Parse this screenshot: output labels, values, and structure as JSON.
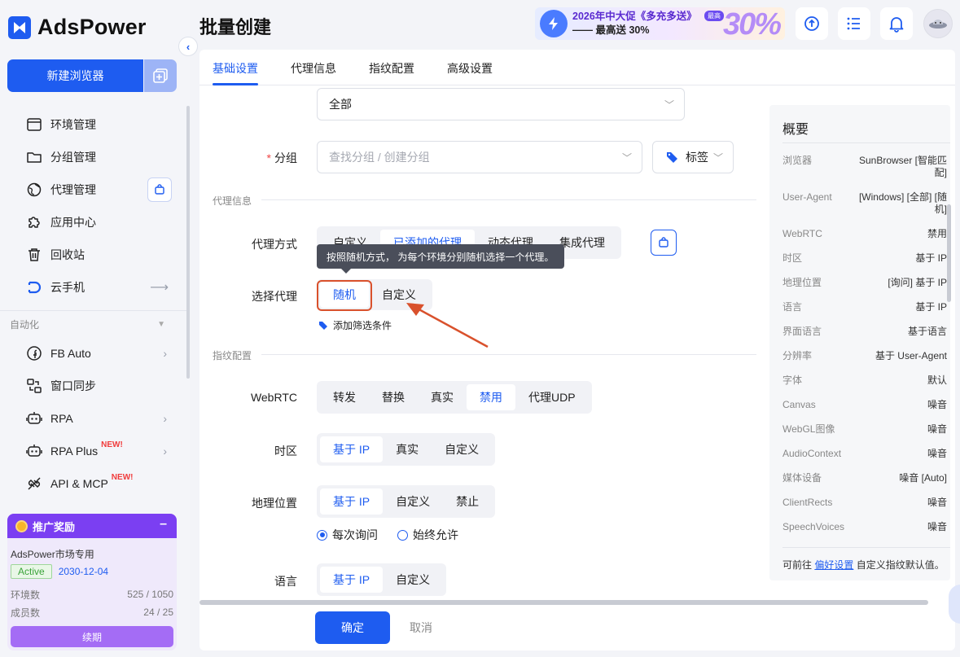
{
  "brand": {
    "name": "AdsPower"
  },
  "sidebar": {
    "new_browser": "新建浏览器",
    "nav": [
      {
        "label": "环境管理"
      },
      {
        "label": "分组管理"
      },
      {
        "label": "代理管理"
      },
      {
        "label": "应用中心"
      },
      {
        "label": "回收站"
      },
      {
        "label": "云手机"
      }
    ],
    "section_automation": "自动化",
    "automation": [
      {
        "label": "FB Auto"
      },
      {
        "label": "窗口同步"
      },
      {
        "label": "RPA"
      },
      {
        "label": "RPA Plus",
        "badge": "NEW!"
      },
      {
        "label": "API & MCP",
        "badge": "NEW!"
      }
    ],
    "promo": {
      "title": "推广奖励",
      "market": "AdsPower市场专用",
      "status": "Active",
      "date": "2030-12-04",
      "env_label": "环境数",
      "env_value": "525 / 1050",
      "member_label": "成员数",
      "member_value": "24 / 25",
      "renew": "续期"
    }
  },
  "header": {
    "title": "批量创建",
    "banner_line1": "2026年中大促《多充多送》",
    "banner_line2": "—— 最高送 30%",
    "banner_big": "30%",
    "banner_pill": "最高"
  },
  "tabs": [
    {
      "label": "基础设置",
      "active": true
    },
    {
      "label": "代理信息"
    },
    {
      "label": "指纹配置"
    },
    {
      "label": "高级设置"
    }
  ],
  "form": {
    "top_select_value": "全部",
    "group_label": "分组",
    "group_placeholder": "查找分组 / 创建分组",
    "tag_label": "标签",
    "section_proxy": "代理信息",
    "proxy_method_label": "代理方式",
    "proxy_methods": [
      "自定义",
      "已添加的代理",
      "动态代理",
      "集成代理"
    ],
    "tooltip": "按照随机方式， 为每个环境分别随机选择一个代理。",
    "select_proxy_label": "选择代理",
    "select_proxy_options": [
      "随机",
      "自定义"
    ],
    "add_filter": "添加筛选条件",
    "section_fingerprint": "指纹配置",
    "webrtc_label": "WebRTC",
    "webrtc_options": [
      "转发",
      "替换",
      "真实",
      "禁用",
      "代理UDP"
    ],
    "timezone_label": "时区",
    "timezone_options": [
      "基于 IP",
      "真实",
      "自定义"
    ],
    "geo_label": "地理位置",
    "geo_options": [
      "基于 IP",
      "自定义",
      "禁止"
    ],
    "geo_radio": [
      "每次询问",
      "始终允许"
    ],
    "lang_label": "语言",
    "lang_options": [
      "基于 IP",
      "自定义"
    ]
  },
  "footer": {
    "confirm": "确定",
    "cancel": "取消"
  },
  "overview": {
    "title": "概要",
    "rows": [
      {
        "k": "浏览器",
        "v": "SunBrowser [智能匹配]"
      },
      {
        "k": "User-Agent",
        "v": "[Windows] [全部] [随机]"
      },
      {
        "k": "WebRTC",
        "v": "禁用"
      },
      {
        "k": "时区",
        "v": "基于 IP"
      },
      {
        "k": "地理位置",
        "v": "[询问] 基于 IP"
      },
      {
        "k": "语言",
        "v": "基于 IP"
      },
      {
        "k": "界面语言",
        "v": "基于语言"
      },
      {
        "k": "分辨率",
        "v": "基于 User-Agent"
      },
      {
        "k": "字体",
        "v": "默认"
      },
      {
        "k": "Canvas",
        "v": "噪音"
      },
      {
        "k": "WebGL图像",
        "v": "噪音"
      },
      {
        "k": "AudioContext",
        "v": "噪音"
      },
      {
        "k": "媒体设备",
        "v": "噪音 [Auto]"
      },
      {
        "k": "ClientRects",
        "v": "噪音"
      },
      {
        "k": "SpeechVoices",
        "v": "噪音"
      }
    ],
    "foot_prefix": "可前往",
    "foot_link": "偏好设置",
    "foot_suffix": "自定义指纹默认值。"
  }
}
